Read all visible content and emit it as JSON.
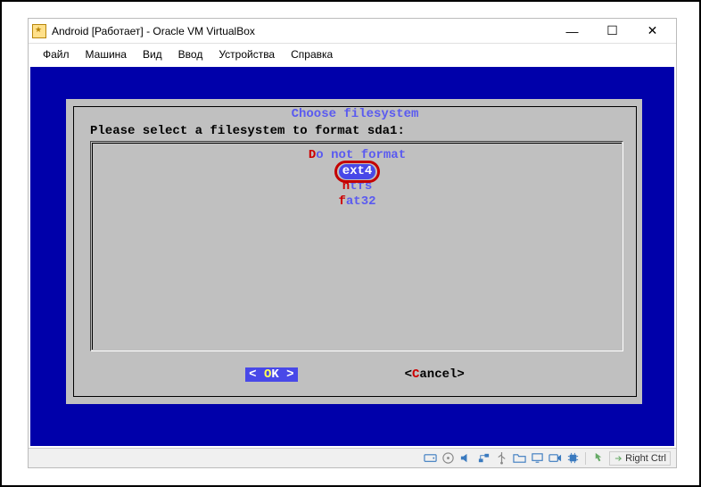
{
  "window": {
    "title": "Android [Работает] - Oracle VM VirtualBox"
  },
  "menu": {
    "file": "Файл",
    "machine": "Машина",
    "view": "Вид",
    "input": "Ввод",
    "devices": "Устройства",
    "help": "Справка"
  },
  "dialog": {
    "title": " Choose filesystem ",
    "prompt": "Please select a filesystem to format sda1:",
    "options": {
      "noformat_hk": "D",
      "noformat_rest": "o not format",
      "ext4": "ext4",
      "ntfs_hk": "n",
      "ntfs_rest": "tfs",
      "fat32_hk": "f",
      "fat32_rest": "at32"
    },
    "ok_left": "<  ",
    "ok_hk": "O",
    "ok_rest": "K  >",
    "cancel_left": "<",
    "cancel_hk": "C",
    "cancel_rest": "ancel>"
  },
  "statusbar": {
    "host_key": "Right Ctrl"
  },
  "icons": {
    "hdd": "hdd-icon",
    "cd": "cd-icon",
    "audio": "audio-icon",
    "network": "network-icon",
    "usb": "usb-icon",
    "shared": "shared-folder-icon",
    "display": "display-icon",
    "record": "record-icon",
    "cpu": "cpu-icon",
    "mouse": "mouse-icon",
    "kbd_arrow": "keyboard-arrow-icon"
  }
}
